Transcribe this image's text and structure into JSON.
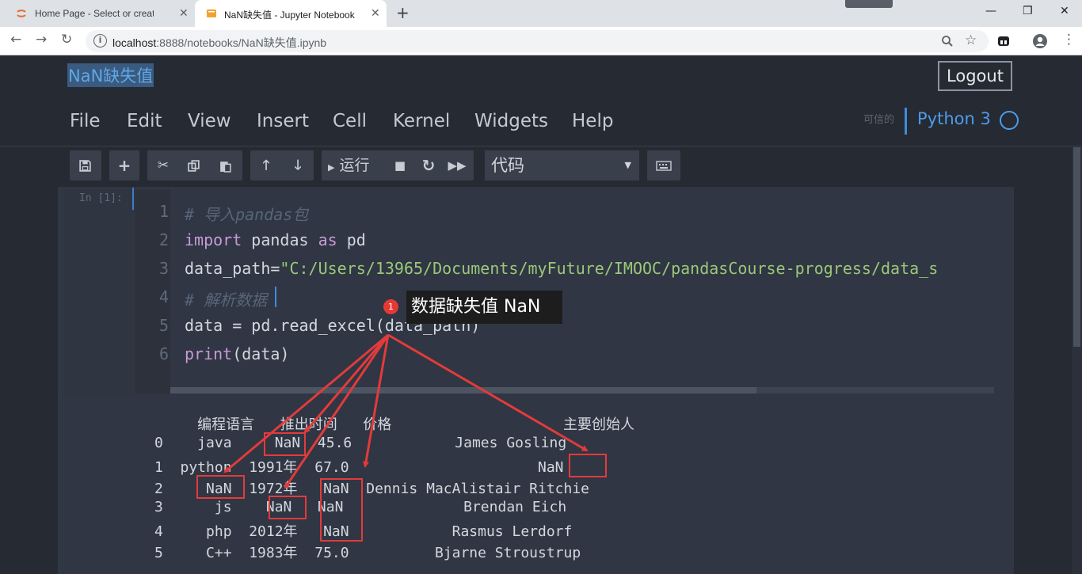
{
  "browser": {
    "tabs": [
      {
        "label": "Home Page - Select or create a notebook",
        "icon": "jupyter-icon"
      },
      {
        "label": "NaN缺失值 - Jupyter Notebook",
        "icon": "notebook-icon"
      }
    ],
    "new_tab": "+",
    "url": "localhost:8888/notebooks/NaN缺失值.ipynb",
    "url_host": "localhost",
    "url_rest": ":8888/notebooks/NaN缺失值.ipynb"
  },
  "notebook": {
    "title": "NaN缺失值",
    "logout_label": "Logout",
    "menu": [
      "File",
      "Edit",
      "View",
      "Insert",
      "Cell",
      "Kernel",
      "Widgets",
      "Help"
    ],
    "trusted_label": "可信的",
    "kernel_name": "Python 3",
    "toolbar": {
      "run_label": "运行",
      "cell_type": "代码"
    }
  },
  "cell": {
    "prompt": "In [1]:",
    "line_numbers": [
      "1",
      "2",
      "3",
      "4",
      "5",
      "6"
    ],
    "code": {
      "l1": "# 导入pandas包",
      "l2_kw1": "import",
      "l2_mod": " pandas ",
      "l2_kw2": "as",
      "l2_alias": " pd",
      "l3_var": "data_path=",
      "l3_str": "\"C:/Users/13965/Documents/myFuture/IMOOC/pandasCourse-progress/data_s",
      "l4": "# 解析数据",
      "l5": "data = pd.read_excel(data_path)",
      "l6_fn": "print",
      "l6_rest": "(data)"
    },
    "output_lines": [
      "     编程语言   推出时间   价格                    主要创始人",
      "0    java     NaN  45.6            James Gosling",
      "1  python  1991年  67.0                      NaN",
      "2     NaN  1972年   NaN  Dennis MacAlistair Ritchie",
      "3      js    NaN   NaN              Brendan Eich",
      "4     php  2012年   NaN            Rasmus Lerdorf",
      "5     C++  1983年  75.0          Bjarne Stroustrup"
    ]
  },
  "annotation": {
    "badge": "1",
    "callout": "数据缺失值 NaN",
    "color": "#e23b3b"
  }
}
